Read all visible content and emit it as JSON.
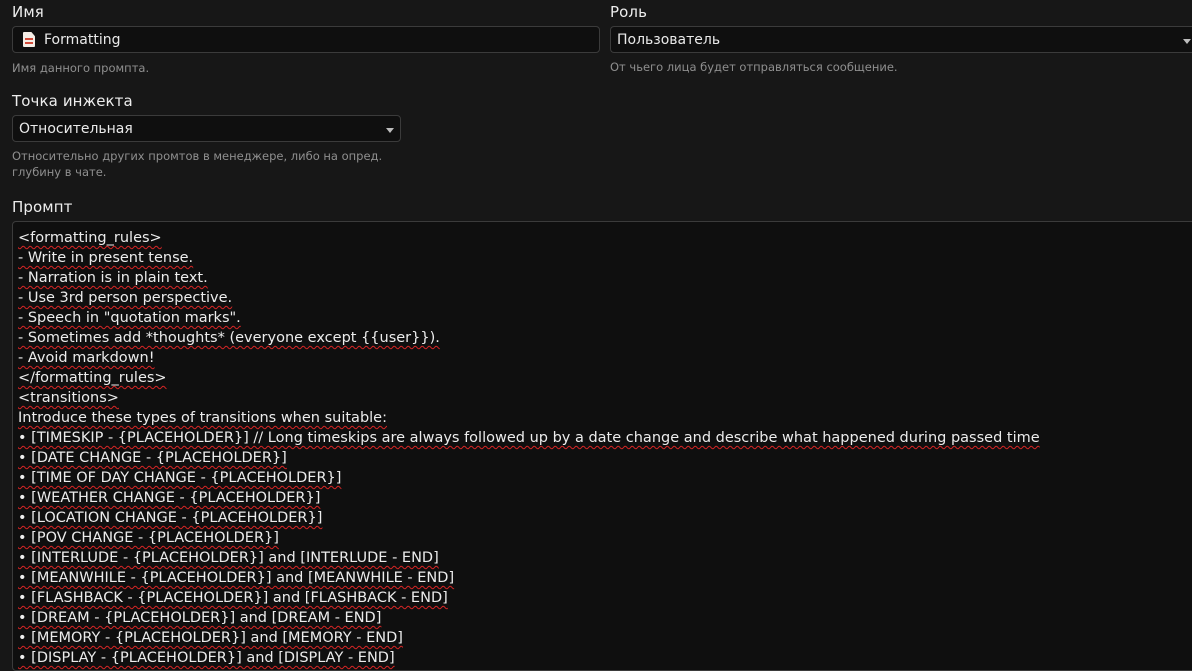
{
  "name": {
    "label": "Имя",
    "value": "Formatting",
    "hint": "Имя данного промпта."
  },
  "role": {
    "label": "Роль",
    "value": "Пользователь",
    "hint": "От чьего лица будет отправляться сообщение."
  },
  "injection": {
    "label": "Точка инжекта",
    "value": "Относительная",
    "hint_line1": "Относительно других промтов в менеджере, либо на опред.",
    "hint_line2": "глубину в чате."
  },
  "prompt": {
    "label": "Промпт",
    "lines": [
      "<formatting_rules>",
      "- Write in present tense.",
      "- Narration is in plain text.",
      "- Use 3rd person perspective.",
      "- Speech in \"quotation marks\".",
      "- Sometimes add *thoughts* (everyone except {{user}}).",
      "- Avoid markdown!",
      "</formatting_rules>",
      "<transitions>",
      "Introduce these types of transitions when suitable:",
      "• [TIMESKIP - {PLACEHOLDER}] // Long timeskips are always followed up by a date change and describe what happened during passed time",
      "• [DATE CHANGE - {PLACEHOLDER}]",
      "• [TIME OF DAY CHANGE - {PLACEHOLDER}]",
      "• [WEATHER CHANGE - {PLACEHOLDER}]",
      "• [LOCATION CHANGE - {PLACEHOLDER}]",
      "• [POV CHANGE - {PLACEHOLDER}]",
      "• [INTERLUDE - {PLACEHOLDER}] and [INTERLUDE - END]",
      "• [MEANWHILE - {PLACEHOLDER}] and [MEANWHILE - END]",
      "• [FLASHBACK - {PLACEHOLDER}] and [FLASHBACK - END]",
      "• [DREAM - {PLACEHOLDER}] and [DREAM - END]",
      "• [MEMORY - {PLACEHOLDER}] and [MEMORY - END]",
      "• [DISPLAY - {PLACEHOLDER}] and [DISPLAY - END]"
    ]
  }
}
